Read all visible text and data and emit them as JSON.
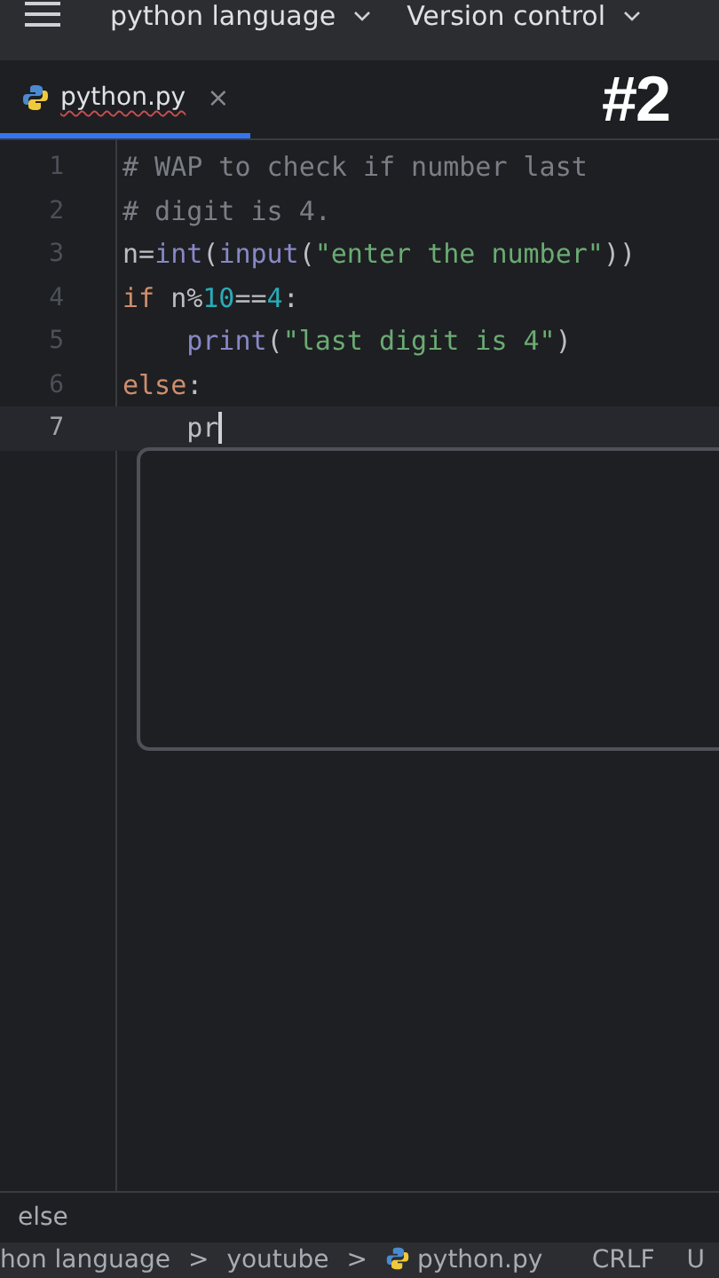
{
  "toolbar": {
    "menus": [
      {
        "label": "python language"
      },
      {
        "label": "Version control"
      }
    ]
  },
  "tabs": [
    {
      "label": "python.py",
      "close": "×",
      "selected": true
    }
  ],
  "overlay_badge": "#2",
  "editor": {
    "lines": [
      {
        "number": "1",
        "current": false,
        "tokens": [
          {
            "kind": "comment",
            "text": "# WAP to check if number last"
          }
        ]
      },
      {
        "number": "2",
        "current": false,
        "tokens": [
          {
            "kind": "comment",
            "text": "# digit is 4."
          }
        ]
      },
      {
        "number": "3",
        "current": false,
        "tokens": [
          {
            "kind": "plain",
            "text": "n="
          },
          {
            "kind": "builtin",
            "text": "int"
          },
          {
            "kind": "plain",
            "text": "("
          },
          {
            "kind": "builtin",
            "text": "input"
          },
          {
            "kind": "plain",
            "text": "("
          },
          {
            "kind": "string",
            "text": "\"enter the number\""
          },
          {
            "kind": "plain",
            "text": "))"
          }
        ]
      },
      {
        "number": "4",
        "current": false,
        "tokens": [
          {
            "kind": "keyword",
            "text": "if "
          },
          {
            "kind": "plain",
            "text": "n%"
          },
          {
            "kind": "number",
            "text": "10"
          },
          {
            "kind": "plain",
            "text": "=="
          },
          {
            "kind": "number",
            "text": "4"
          },
          {
            "kind": "plain",
            "text": ":"
          }
        ]
      },
      {
        "number": "5",
        "current": false,
        "tokens": [
          {
            "kind": "builtin",
            "text": "    print"
          },
          {
            "kind": "plain",
            "text": "("
          },
          {
            "kind": "string",
            "text": "\"last digit is 4\""
          },
          {
            "kind": "plain",
            "text": ")"
          }
        ]
      },
      {
        "number": "6",
        "current": false,
        "tokens": [
          {
            "kind": "keyword",
            "text": "else"
          },
          {
            "kind": "plain",
            "text": ":"
          }
        ]
      },
      {
        "number": "7",
        "current": true,
        "tokens": [
          {
            "kind": "plain",
            "text": "    pr"
          }
        ]
      }
    ],
    "completion_popup": {
      "kind": "empty"
    }
  },
  "breadcrumb": "else",
  "status_bar": {
    "path": [
      "hon language",
      "youtube",
      "python.py"
    ],
    "separator": ">",
    "items": [
      "CRLF",
      "U"
    ]
  }
}
